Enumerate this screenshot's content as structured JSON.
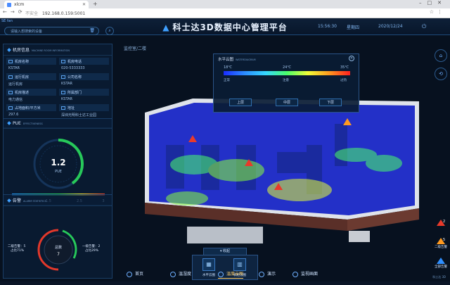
{
  "browser": {
    "tab_title": "xlcm",
    "insecure_label": "不安全",
    "url": "192.168.0.159:5001"
  },
  "header": {
    "logo_text": "SE fan",
    "search_placeholder": "请输入想搜索的设备",
    "title": "科士达3D数据中心管理平台",
    "time": "15:56:30",
    "weekday": "星期四",
    "date": "2020/12/24"
  },
  "room_info": {
    "title": "机房信息",
    "subtitle": "MACHINE ROOM INFORMATION",
    "fields": [
      {
        "label": "机房名称",
        "value": "KSTAR"
      },
      {
        "label": "机房电话",
        "value": "020-5333333"
      },
      {
        "label": "运行机房",
        "value": "运行机房"
      },
      {
        "label": "公司名称",
        "value": "KSTAR"
      },
      {
        "label": "机房描述",
        "value": "电力通信"
      },
      {
        "label": "所属部门",
        "value": "KSTAR"
      },
      {
        "label": "占地面积/平方米",
        "value": "297.6"
      },
      {
        "label": "地址",
        "value": "深圳光明科士达工业园"
      }
    ]
  },
  "pue": {
    "title": "PUE",
    "subtitle": "EFFECTIVENESS",
    "value": "1.2",
    "unit": "PUE",
    "scale_labels": [
      "0",
      "1.5",
      "2.5",
      "3"
    ],
    "level": 0.4
  },
  "alarm": {
    "title": "告警",
    "subtitle": "ALARM STATISTICS",
    "total_label": "总数",
    "total": "7",
    "left_label": "二级告警：5",
    "left_pct": "占比71%",
    "right_label": "一级告警：2",
    "right_pct": "占比29%",
    "colors": {
      "level2": "#e2382b",
      "level1": "#27c95a"
    }
  },
  "scene": {
    "breadcrumb": "监控室/二楼",
    "heat_panel": {
      "title": "水平云图",
      "subtitle": "WATERDIAGRAM",
      "ticks_top": [
        "18℃",
        "24℃",
        "35℃"
      ],
      "ticks_bottom": [
        "正常",
        "注意",
        "过热"
      ],
      "buttons": [
        "上层",
        "中层",
        "下层"
      ]
    },
    "alarm_counts": [
      {
        "label": "2",
        "name": ""
      },
      {
        "label": "5",
        "name": "二级告警"
      },
      {
        "label": "",
        "name": "全部告警"
      }
    ]
  },
  "collapse_label": "收起",
  "subnav": [
    "水平云图",
    "机柜温图"
  ],
  "bottom_nav": [
    {
      "label": "首页",
      "icon": "home-icon"
    },
    {
      "label": "温湿度",
      "icon": "thermometer-icon"
    },
    {
      "label": "温度云图",
      "icon": "cloud-icon",
      "active": true
    },
    {
      "label": "演示",
      "icon": "play-icon"
    },
    {
      "label": "监视画面",
      "icon": "monitor-icon"
    }
  ],
  "footer": "科士达 3D"
}
